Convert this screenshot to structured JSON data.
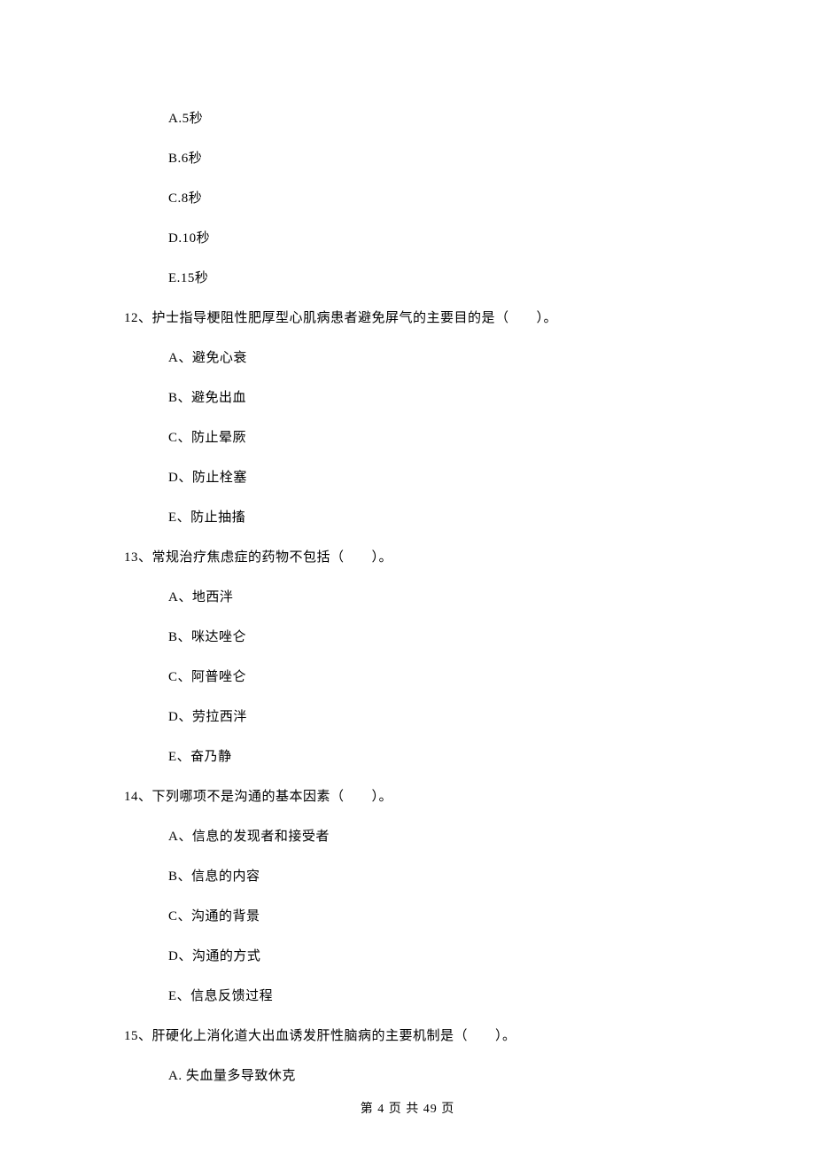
{
  "first_options": {
    "a": "A.5秒",
    "b": "B.6秒",
    "c": "C.8秒",
    "d": "D.10秒",
    "e": "E.15秒"
  },
  "q12": {
    "stem": "12、护士指导梗阻性肥厚型心肌病患者避免屏气的主要目的是（　　）。",
    "a": "A、避免心衰",
    "b": "B、避免出血",
    "c": "C、防止晕厥",
    "d": "D、防止栓塞",
    "e": "E、防止抽搐"
  },
  "q13": {
    "stem": "13、常规治疗焦虑症的药物不包括（　　）。",
    "a": "A、地西泮",
    "b": "B、咪达唑仑",
    "c": "C、阿普唑仑",
    "d": "D、劳拉西泮",
    "e": "E、奋乃静"
  },
  "q14": {
    "stem": "14、下列哪项不是沟通的基本因素（　　）。",
    "a": "A、信息的发现者和接受者",
    "b": "B、信息的内容",
    "c": "C、沟通的背景",
    "d": "D、沟通的方式",
    "e": "E、信息反馈过程"
  },
  "q15": {
    "stem": "15、肝硬化上消化道大出血诱发肝性脑病的主要机制是（　　）。",
    "a": "A. 失血量多导致休克"
  },
  "footer": "第 4 页 共 49 页"
}
